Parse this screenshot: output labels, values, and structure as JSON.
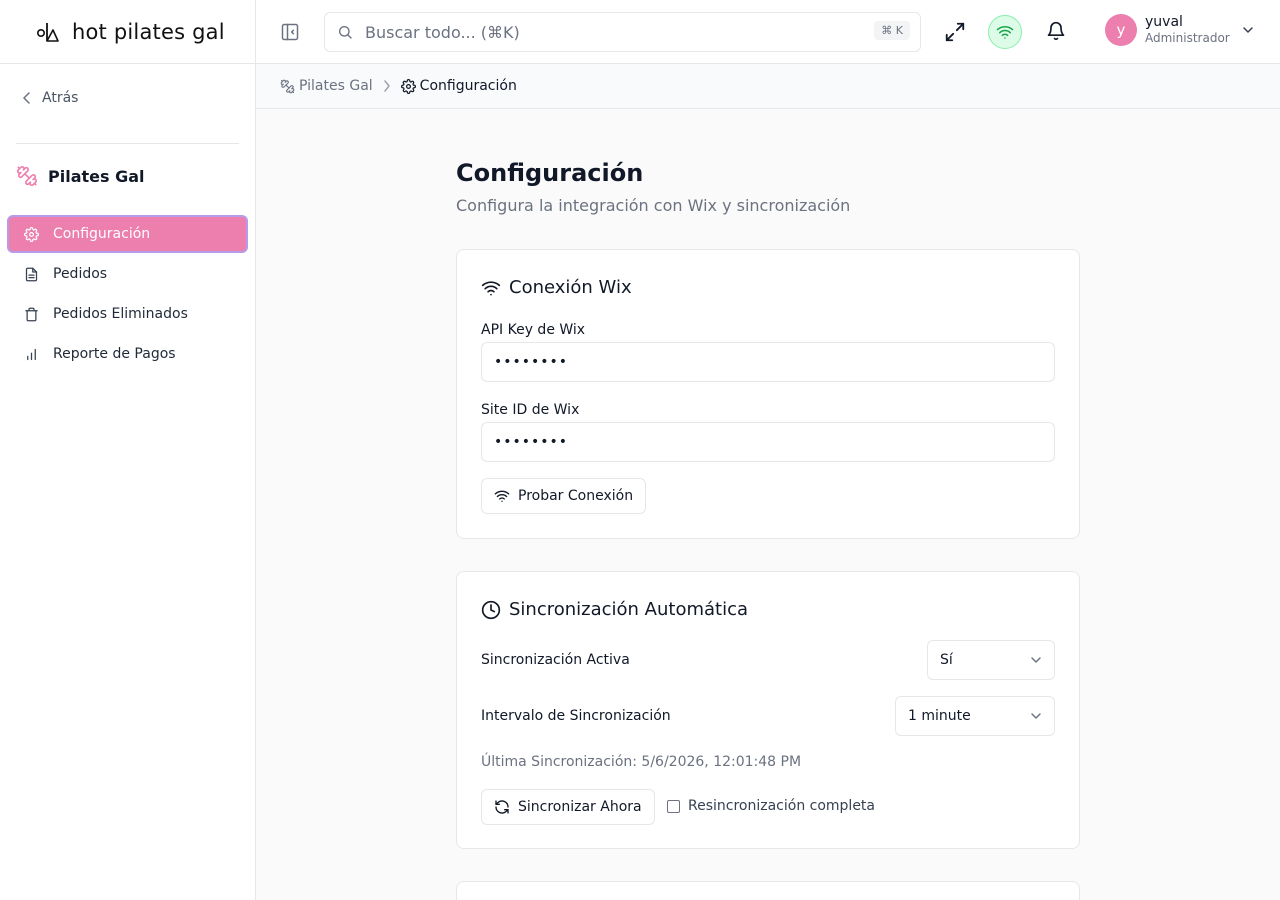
{
  "brand": {
    "name": "hot pilates gal",
    "accent": "#ec7fae"
  },
  "sidebar": {
    "back_label": "Atrás",
    "workspace": "Pilates Gal",
    "items": [
      {
        "label": "Configuración",
        "icon": "gear-icon",
        "active": true
      },
      {
        "label": "Pedidos",
        "icon": "document-icon",
        "active": false
      },
      {
        "label": "Pedidos Eliminados",
        "icon": "trash-icon",
        "active": false
      },
      {
        "label": "Reporte de Pagos",
        "icon": "bar-chart-icon",
        "active": false
      }
    ]
  },
  "topbar": {
    "search_placeholder": "Buscar todo... (⌘K)",
    "search_shortcut": "⌘ K",
    "user": {
      "initial": "y",
      "name": "yuval",
      "role": "Administrador"
    }
  },
  "breadcrumb": {
    "parent": "Pilates Gal",
    "current": "Configuración"
  },
  "page": {
    "title": "Configuración",
    "subtitle": "Configura la integración con Wix y sincronización"
  },
  "wix_card": {
    "title": "Conexión Wix",
    "api_key_label": "API Key de Wix",
    "api_key_value": "••••••••",
    "site_id_label": "Site ID de Wix",
    "site_id_value": "••••••••",
    "test_button": "Probar Conexión"
  },
  "sync_card": {
    "title": "Sincronización Automática",
    "active_label": "Sincronización Activa",
    "active_value": "Sí",
    "interval_label": "Intervalo de Sincronización",
    "interval_value": "1 minute",
    "last_sync": "Última Sincronización: 5/6/2026, 12:01:48 PM",
    "sync_button": "Sincronizar Ahora",
    "full_resync_label": "Resincronización completa",
    "full_resync_checked": false
  }
}
